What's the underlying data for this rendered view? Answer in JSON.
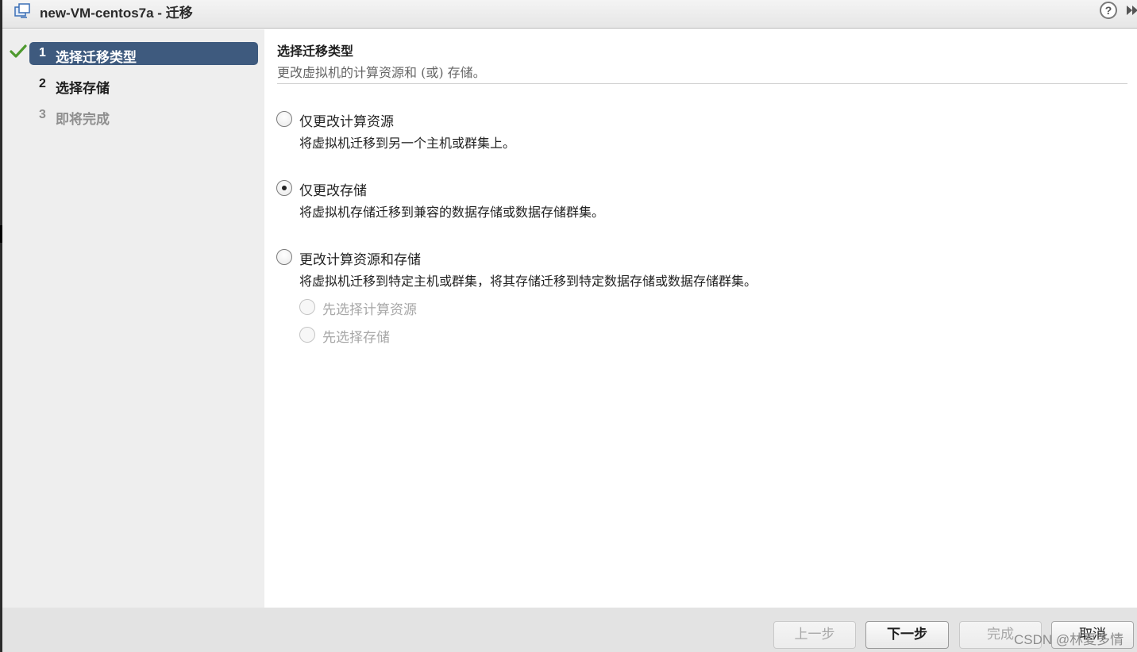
{
  "window": {
    "title": "new-VM-centos7a - 迁移",
    "help_icon": "help-icon",
    "help_glyph": "?",
    "expand_icon": "expand-icon"
  },
  "steps": [
    {
      "number": "1",
      "label": "选择迁移类型",
      "state": "active",
      "completed": true
    },
    {
      "number": "2",
      "label": "选择存储",
      "state": "normal"
    },
    {
      "number": "3",
      "label": "即将完成",
      "state": "disabled"
    }
  ],
  "section": {
    "title": "选择迁移类型",
    "subtitle": "更改虚拟机的计算资源和 (或) 存储。"
  },
  "options": [
    {
      "label": "仅更改计算资源",
      "description": "将虚拟机迁移到另一个主机或群集上。",
      "selected": false
    },
    {
      "label": "仅更改存储",
      "description": "将虚拟机存储迁移到兼容的数据存储或数据存储群集。",
      "selected": true
    },
    {
      "label": "更改计算资源和存储",
      "description": "将虚拟机迁移到特定主机或群集，将其存储迁移到特定数据存储或数据存储群集。",
      "selected": false
    }
  ],
  "sub_options": [
    {
      "label": "先选择计算资源",
      "enabled": false
    },
    {
      "label": "先选择存储",
      "enabled": false
    }
  ],
  "footer": {
    "back_label": "上一步",
    "next_label": "下一步",
    "finish_label": "完成",
    "cancel_label": "取消"
  },
  "watermark": "CSDN @林夏多情",
  "colors": {
    "active_step": "#3e5a7e",
    "check_green": "#4f9a2f",
    "sidebar_bg": "#eeeeee",
    "footer_bg": "#e3e3e3"
  }
}
